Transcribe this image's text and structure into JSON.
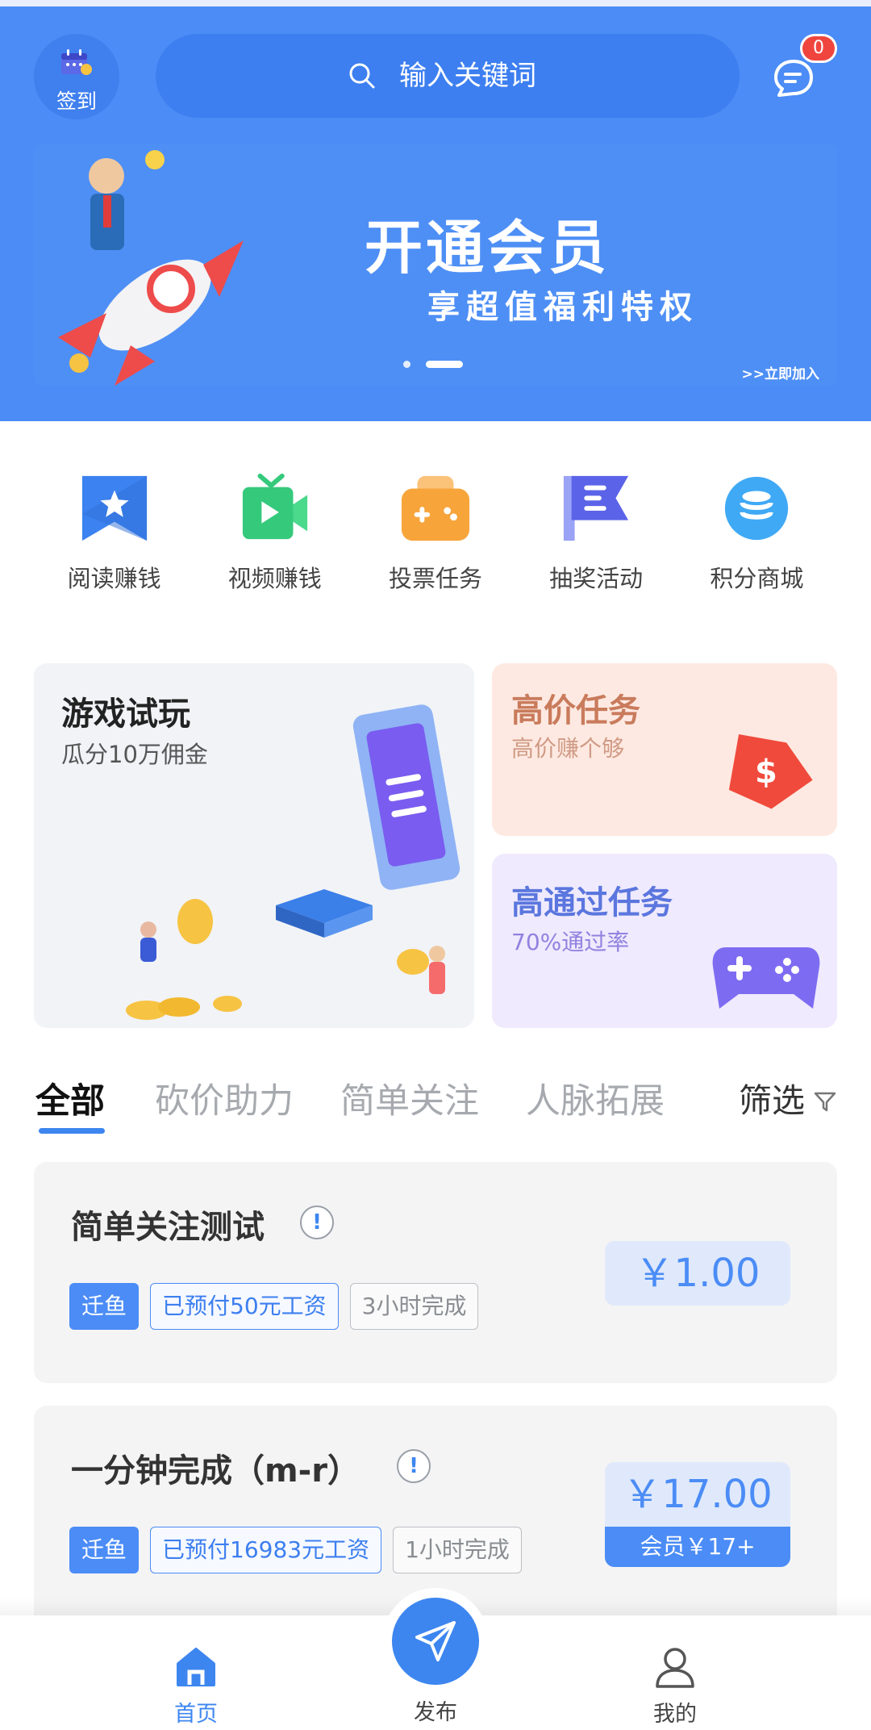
{
  "header": {
    "checkin_label": "签到",
    "search_placeholder": "输入关键词",
    "message_count": "0"
  },
  "banner": {
    "title": "开通会员",
    "subtitle": "享超值福利特权",
    "join_label": ">>立即加入",
    "slide_count": 2,
    "active_slide": 2
  },
  "quick_actions": [
    {
      "label": "阅读赚钱",
      "icon": "bookmark-star-icon",
      "color": "#3c82f0"
    },
    {
      "label": "视频赚钱",
      "icon": "video-camera-icon",
      "color": "#35c97c"
    },
    {
      "label": "投票任务",
      "icon": "gamepad-bag-icon",
      "color": "#f7a43a"
    },
    {
      "label": "抽奖活动",
      "icon": "flag-list-icon",
      "color": "#5b63e8"
    },
    {
      "label": "积分商城",
      "icon": "database-icon",
      "color": "#3fa9f5"
    }
  ],
  "features": {
    "game_trial": {
      "title": "游戏试玩",
      "subtitle": "瓜分10万佣金"
    },
    "high_price": {
      "title": "高价任务",
      "subtitle": "高价赚个够"
    },
    "high_pass": {
      "title": "高通过任务",
      "subtitle": "70%通过率"
    }
  },
  "tabs": {
    "items": [
      "全部",
      "砍价助力",
      "简单关注",
      "人脉拓展"
    ],
    "active": "全部",
    "filter_label": "筛选"
  },
  "tasks": [
    {
      "name": "简单关注测试",
      "tags": {
        "owner": "迁鱼",
        "pay": "已预付50元工资",
        "time": "3小时完成"
      },
      "price": "￥1.00"
    },
    {
      "name": "一分钟完成（m-r）",
      "tags": {
        "owner": "迁鱼",
        "pay": "已预付16983元工资",
        "time": "1小时完成"
      },
      "price": "￥17.00",
      "member_price": "会员￥17+"
    }
  ],
  "bottom_nav": {
    "home": "首页",
    "publish": "发布",
    "me": "我的",
    "active": "首页"
  },
  "colors": {
    "primary": "#4b8cf6",
    "badge": "#f0453f"
  }
}
